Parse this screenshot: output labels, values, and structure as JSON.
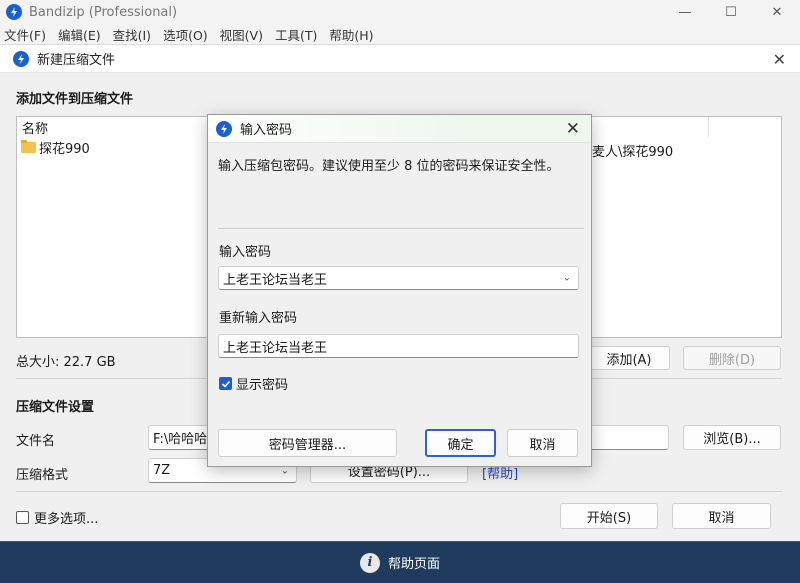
{
  "window": {
    "title": "Bandizip (Professional)",
    "controls": {
      "minimize": "—",
      "maximize": "☐",
      "close": "✕"
    }
  },
  "menu": {
    "items": [
      "文件(F)",
      "编辑(E)",
      "查找(I)",
      "选项(O)",
      "视图(V)",
      "工具(T)",
      "帮助(H)"
    ]
  },
  "new_archive_dialog": {
    "title": "新建压缩文件",
    "close": "✕",
    "add_files_section": "添加文件到压缩文件",
    "file_list": {
      "column_name": "名称",
      "rows": [
        {
          "name": "探花990",
          "path": "麦人\\探花990"
        }
      ]
    },
    "total_size": "总大小: 22.7 GB",
    "add_button": "添加(A)",
    "delete_button": "删除(D)",
    "settings_section": "压缩文件设置",
    "filename_label": "文件名",
    "filename_value": "F:\\哈哈哈哈",
    "browse_button": "浏览(B)...",
    "format_label": "压缩格式",
    "format_value": "7Z",
    "set_password_button": "设置密码(P)...",
    "help_link": "[帮助]",
    "more_options": "更多选项...",
    "start_button": "开始(S)",
    "cancel_button": "取消"
  },
  "password_modal": {
    "title": "输入密码",
    "close": "✕",
    "description": "输入压缩包密码。建议使用至少 8 位的密码来保证安全性。",
    "password_label": "输入密码",
    "password_value": "上老王论坛当老王",
    "reenter_label": "重新输入密码",
    "reenter_value": "上老王论坛当老王",
    "show_password_label": "显示密码",
    "show_password_checked": true,
    "manager_button": "密码管理器...",
    "ok_button": "确定",
    "cancel_button": "取消"
  },
  "taskbar": {
    "help_page": "帮助页面"
  },
  "colors": {
    "accent": "#1a5fd6",
    "taskbar": "#1f3b5e",
    "link": "#2a47c9"
  }
}
